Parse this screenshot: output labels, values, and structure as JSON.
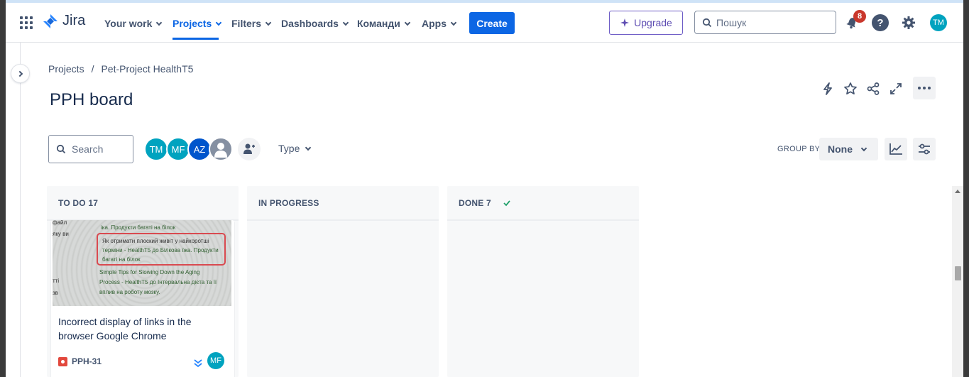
{
  "topnav": {
    "logo": "Jira",
    "items": [
      {
        "label": "Your work"
      },
      {
        "label": "Projects"
      },
      {
        "label": "Filters"
      },
      {
        "label": "Dashboards"
      },
      {
        "label": "Команди"
      },
      {
        "label": "Apps"
      }
    ],
    "create_label": "Create",
    "upgrade_label": "Upgrade",
    "search_placeholder": "Пошук",
    "notifications_count": "8",
    "user_initials": "TM",
    "accent": "#0c66e4"
  },
  "breadcrumb": {
    "root": "Projects",
    "separator": "/",
    "project": "Pet-Project HealthT5"
  },
  "page_title": "PPH board",
  "filters": {
    "search_placeholder": "Search",
    "avatars": [
      {
        "initials": "TM",
        "color": "#00a3bf"
      },
      {
        "initials": "MF",
        "color": "#00a3bf"
      },
      {
        "initials": "AZ",
        "color": "#0055cc"
      }
    ],
    "type_label": "Type",
    "group_by_label": "GROUP BY",
    "group_by_value": "None"
  },
  "columns": [
    {
      "title": "TO DO 17"
    },
    {
      "title": "IN PROGRESS"
    },
    {
      "title": "DONE 7"
    }
  ],
  "card": {
    "image_lines": [
      "файл",
      "яку ви",
      "тті",
      "зв"
    ],
    "image_green_lines": [
      "іка. Продукти багаті на білок",
      "Як отримати плоский живіт у найкоротші",
      "терміни - HealthT5 до Білкова їжа. Продукти",
      "багаті на білок",
      "Simple Tips for Slowing Down the Aging",
      "Process - HealthT5 до Інтервальна дієта та її",
      "вплив на роботу мозку."
    ],
    "title": "Incorrect display of links in the browser Google Chrome",
    "key": "PPH-31",
    "assignee": "MF"
  }
}
